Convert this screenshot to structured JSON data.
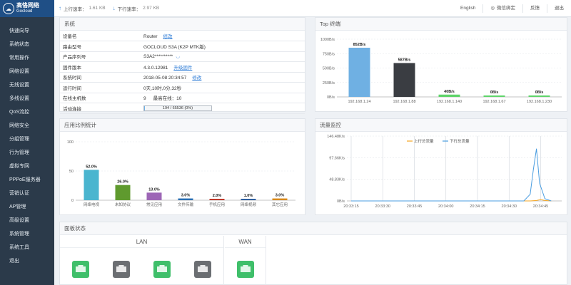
{
  "brand": {
    "name_cn": "高恪网络",
    "name_en": "Gocloud"
  },
  "nav": [
    "快速向导",
    "系统状态",
    "常用操作",
    "网络设置",
    "无线设置",
    "多线设置",
    "QoS流控",
    "网络安全",
    "分组管理",
    "行为管理",
    "虚拟专网",
    "PPPoE服务器",
    "营销认证",
    "AP管理",
    "高级设置",
    "系统管理",
    "系统工具",
    "退出"
  ],
  "topbar": {
    "up_label": "上行速率：",
    "up_value": "1.61 KB",
    "down_label": "下行速率：",
    "down_value": "2.97 KB",
    "lang": "English",
    "wechat": "微信绑定",
    "feedback": "反馈",
    "logout": "退出"
  },
  "system": {
    "title": "系统",
    "rows": [
      {
        "key": "设备名",
        "value": "Router",
        "link": "修改"
      },
      {
        "key": "路由型号",
        "value": "GOCLOUD S3A (K2P MTK版)",
        "link": ""
      },
      {
        "key": "产品序列号",
        "value": "S3A2**********",
        "link": ""
      },
      {
        "key": "固件版本",
        "value": "4.3.0.12981",
        "link": "升级固件"
      },
      {
        "key": "系统时间",
        "value": "2018-05-08 20:34:57",
        "link": "修改"
      },
      {
        "key": "运行时间",
        "value": "0天,10时,0分,32秒",
        "link": ""
      },
      {
        "key": "在线主机数",
        "value": "9",
        "extra": "最高在线：10",
        "link": ""
      }
    ],
    "conn_label": "活动连接",
    "conn_text": "194 / 65536 (0%)",
    "conn_fraction": 0.003
  },
  "top_panel": {
    "title": "Top 终端"
  },
  "ratio_panel": {
    "title": "应用比例统计"
  },
  "flow_panel": {
    "title": "流量监控"
  },
  "board_panel": {
    "title": "面板状态",
    "lan_label": "LAN",
    "wan_label": "WAN"
  },
  "ports": {
    "lan": [
      {
        "color": "#3fbf6a"
      },
      {
        "color": "#6b6e72"
      },
      {
        "color": "#3fbf6a"
      },
      {
        "color": "#6b6e72"
      }
    ],
    "wan": [
      {
        "color": "#3fbf6a"
      }
    ]
  },
  "chart_data": [
    {
      "type": "bar",
      "title": "Top 终端",
      "categories": [
        "192.168.1.24",
        "192.168.1.88",
        "192.168.1.140",
        "192.168.1.67",
        "192.168.1.230"
      ],
      "values": [
        852,
        587,
        40,
        0,
        0
      ],
      "value_labels": [
        "852B/s",
        "587B/s",
        "40B/s",
        "0B/s",
        "0B/s"
      ],
      "colors": [
        "#6fb0e3",
        "#3a3d42",
        "#5fd46a",
        "#5fd46a",
        "#5fd46a"
      ],
      "ylim": [
        0,
        1000
      ],
      "yticks": [
        0,
        250,
        500,
        750,
        1000
      ],
      "ytick_labels": [
        "0B/s",
        "250B/s",
        "500B/s",
        "750B/s",
        "1000B/s"
      ],
      "grid": true
    },
    {
      "type": "bar",
      "title": "应用比例统计",
      "categories": [
        "网络电视",
        "未知协议",
        "常见应用",
        "文件传输",
        "手机应用",
        "网络视频",
        "其它应用"
      ],
      "values": [
        52.0,
        26.0,
        13.0,
        3.0,
        2.0,
        1.0,
        3.0
      ],
      "value_labels": [
        "52.0%",
        "26.0%",
        "13.0%",
        "3.0%",
        "2.0%",
        "1.0%",
        "3.0%"
      ],
      "colors": [
        "#4ab5cf",
        "#5f9a2e",
        "#9d66b6",
        "#2a6fb3",
        "#c0392b",
        "#2e5fa0",
        "#d98a1c"
      ],
      "ylim": [
        0,
        100
      ],
      "yticks": [
        0,
        50,
        100
      ],
      "ytick_labels": [
        "0",
        "50",
        "100"
      ],
      "grid": true
    },
    {
      "type": "line",
      "title": "流量监控",
      "x": [
        "20:33:15",
        "20:33:30",
        "20:33:45",
        "20:34:00",
        "20:34:15",
        "20:34:30",
        "20:34:45"
      ],
      "ylim": [
        0,
        146.48
      ],
      "yticks": [
        0,
        48.83,
        97.66,
        146.48
      ],
      "ytick_labels": [
        "0B/s",
        "48.83K/s",
        "97.66K/s",
        "146.48K/s"
      ],
      "grid": true,
      "legend_position": "top",
      "series": [
        {
          "name": "上行总流量",
          "color": "#f5a623",
          "t": [
            0,
            15,
            30,
            45,
            60,
            75,
            85,
            88,
            90,
            92,
            95
          ],
          "values": [
            0,
            0,
            0,
            0,
            0,
            0,
            0,
            1,
            3,
            1,
            0
          ]
        },
        {
          "name": "下行总流量",
          "color": "#4a9de0",
          "t": [
            0,
            15,
            30,
            45,
            60,
            75,
            82,
            85,
            86.5,
            88,
            89.5,
            92,
            95
          ],
          "values": [
            0,
            0,
            0,
            0,
            0,
            0,
            0,
            15,
            70,
            118,
            40,
            5,
            0
          ]
        }
      ]
    }
  ]
}
